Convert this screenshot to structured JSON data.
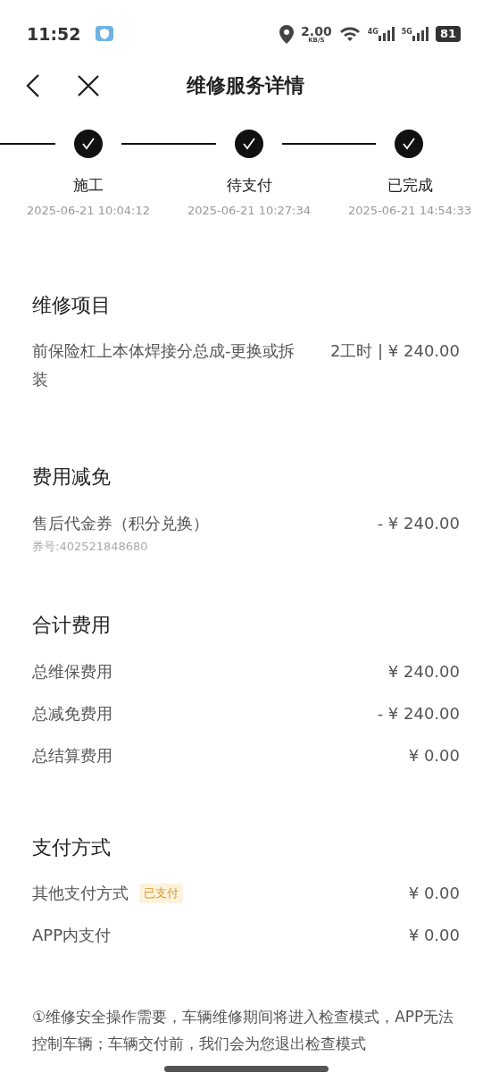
{
  "status_bar": {
    "time": "11:52",
    "speed": "2.00",
    "speed_unit": "KB/S",
    "net_a": "4G",
    "net_b": "5G",
    "battery": "81"
  },
  "header": {
    "title": "维修服务详情"
  },
  "steps": [
    {
      "label": "施工",
      "time": "2025-06-21 10:04:12",
      "done": true
    },
    {
      "label": "待支付",
      "time": "2025-06-21 10:27:34",
      "done": true
    },
    {
      "label": "已完成",
      "time": "2025-06-21 14:54:33",
      "done": true
    }
  ],
  "sections": [
    {
      "title": "维修项目",
      "rows": [
        {
          "label": "前保险杠上本体焊接分总成-更换或拆装",
          "value": "2工时 | ¥ 240.00"
        }
      ]
    },
    {
      "title": "费用减免",
      "rows": [
        {
          "label": "售后代金券（积分兑换）",
          "value": "- ¥ 240.00",
          "sub": "券号:402521848680"
        }
      ]
    },
    {
      "title": "合计费用",
      "rows": [
        {
          "label": "总维保费用",
          "value": "¥ 240.00"
        },
        {
          "label": "总减免费用",
          "value": "- ¥ 240.00"
        },
        {
          "label": "总结算费用",
          "value": "¥ 0.00"
        }
      ]
    },
    {
      "title": "支付方式",
      "rows": [
        {
          "label": "其他支付方式",
          "value": "¥ 0.00",
          "badge": "已支付"
        },
        {
          "label": "APP内支付",
          "value": "¥ 0.00"
        }
      ]
    }
  ],
  "note": "①维修安全操作需要，车辆维修期间将进入检查模式，APP无法控制车辆；车辆交付前，我们会为您退出检查模式"
}
